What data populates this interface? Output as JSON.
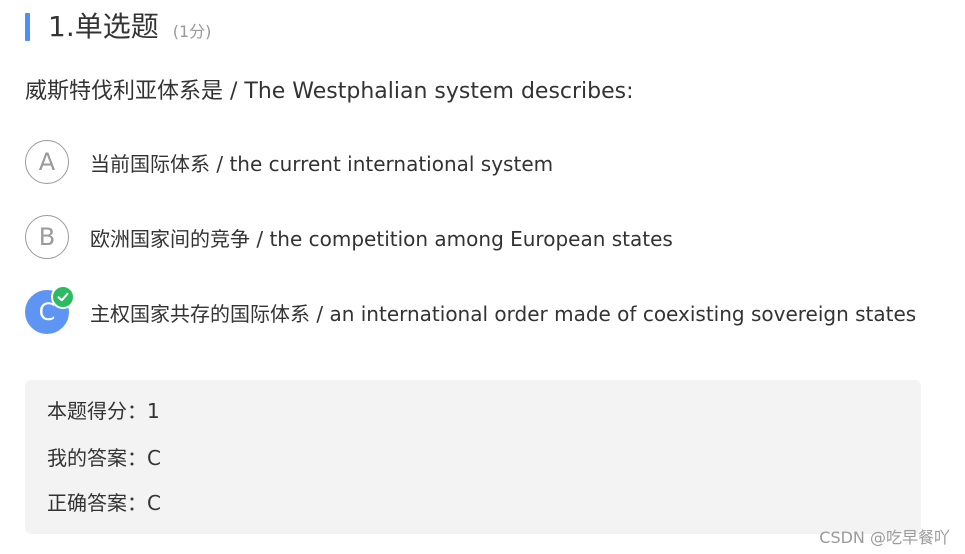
{
  "header": {
    "title": "1.单选题",
    "score": "(1分)",
    "accent_color": "#4d8ef7"
  },
  "question": {
    "text": "威斯特伐利亚体系是 /  The Westphalian system describes:"
  },
  "options": [
    {
      "letter": "A",
      "text": "当前国际体系 / the current international system",
      "selected": false
    },
    {
      "letter": "B",
      "text": "欧洲国家间的竞争 / the competition among European states",
      "selected": false
    },
    {
      "letter": "C",
      "text": "主权国家共存的国际体系 / an international order made of coexisting sovereign states",
      "selected": true,
      "correct_icon": "check-icon"
    }
  ],
  "result": {
    "score_line": "本题得分：1",
    "my_answer_line": "我的答案：C",
    "correct_answer_line": "正确答案：C"
  },
  "watermark": "CSDN @吃早餐吖",
  "colors": {
    "selected_fill": "#5f95f2",
    "correct_badge": "#2dbb61",
    "result_bg": "#f3f3f3"
  }
}
